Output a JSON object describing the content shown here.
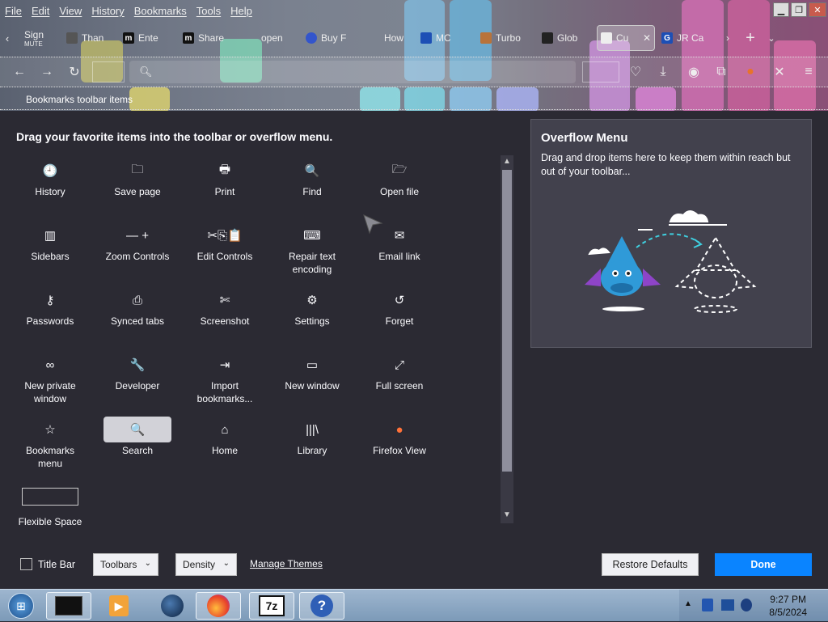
{
  "menubar": {
    "items": [
      "File",
      "Edit",
      "View",
      "History",
      "Bookmarks",
      "Tools",
      "Help"
    ]
  },
  "tabs": [
    {
      "label": "Sign",
      "sub": "MUTE",
      "color": "#333"
    },
    {
      "label": "Than",
      "color": "#555"
    },
    {
      "label": "Ente",
      "color": "#111"
    },
    {
      "label": "Share",
      "color": "#111"
    },
    {
      "label": "open",
      "color": "#666"
    },
    {
      "label": "Buy F",
      "color": "#3355cc"
    },
    {
      "label": "How",
      "color": "#888"
    },
    {
      "label": "MC",
      "color": "#1d4fb5"
    },
    {
      "label": "Turbo",
      "color": "#b8733a"
    },
    {
      "label": "Glob",
      "color": "#222"
    },
    {
      "label": "Cu",
      "color": "#eee",
      "active": true
    },
    {
      "label": "JR Ca",
      "color": "#1d4fb5"
    }
  ],
  "bookmarks_toolbar_label": "Bookmarks toolbar items",
  "instruction": "Drag your favorite items into the toolbar or overflow menu.",
  "palette": [
    {
      "label": "History",
      "icon": "history-icon",
      "glyph": "🕘"
    },
    {
      "label": "Save page",
      "icon": "save-page-icon",
      "glyph": "🗀"
    },
    {
      "label": "Print",
      "icon": "print-icon",
      "glyph": "🖶"
    },
    {
      "label": "Find",
      "icon": "find-icon",
      "glyph": "🔍"
    },
    {
      "label": "Open file",
      "icon": "open-file-icon",
      "glyph": "🗁"
    },
    {
      "label": "Sidebars",
      "icon": "sidebars-icon",
      "glyph": "▥"
    },
    {
      "label": "Zoom Controls",
      "icon": "zoom-controls-icon",
      "glyph": "— +"
    },
    {
      "label": "Edit Controls",
      "icon": "edit-controls-icon",
      "glyph": "✂⎘📋"
    },
    {
      "label": "Repair text encoding",
      "icon": "repair-encoding-icon",
      "glyph": "⌨"
    },
    {
      "label": "Email link",
      "icon": "email-link-icon",
      "glyph": "✉"
    },
    {
      "label": "Passwords",
      "icon": "passwords-icon",
      "glyph": "⚷"
    },
    {
      "label": "Synced tabs",
      "icon": "synced-tabs-icon",
      "glyph": "⎙"
    },
    {
      "label": "Screenshot",
      "icon": "screenshot-icon",
      "glyph": "✄"
    },
    {
      "label": "Settings",
      "icon": "settings-icon",
      "glyph": "⚙"
    },
    {
      "label": "Forget",
      "icon": "forget-icon",
      "glyph": "↺"
    },
    {
      "label": "New private window",
      "icon": "private-window-icon",
      "glyph": "∞"
    },
    {
      "label": "Developer",
      "icon": "developer-icon",
      "glyph": "🔧"
    },
    {
      "label": "Import bookmarks...",
      "icon": "import-bookmarks-icon",
      "glyph": "⇥"
    },
    {
      "label": "New window",
      "icon": "new-window-icon",
      "glyph": "▭"
    },
    {
      "label": "Full screen",
      "icon": "full-screen-icon",
      "glyph": "⤢"
    },
    {
      "label": "Bookmarks menu",
      "icon": "bookmarks-menu-icon",
      "glyph": "☆"
    },
    {
      "label": "Search",
      "icon": "search-icon",
      "glyph": "🔍",
      "selected": true
    },
    {
      "label": "Home",
      "icon": "home-icon",
      "glyph": "⌂"
    },
    {
      "label": "Library",
      "icon": "library-icon",
      "glyph": "|||\\"
    },
    {
      "label": "Firefox View",
      "icon": "firefox-view-icon",
      "glyph": "●"
    }
  ],
  "flexible_space_label": "Flexible Space",
  "overflow": {
    "title": "Overflow Menu",
    "description": "Drag and drop items here to keep them within reach but out of your toolbar..."
  },
  "footer": {
    "title_bar_label": "Title Bar",
    "toolbars_label": "Toolbars",
    "density_label": "Density",
    "manage_themes_label": "Manage Themes",
    "restore_defaults_label": "Restore Defaults",
    "done_label": "Done"
  },
  "clock": {
    "time": "9:27 PM",
    "date": "8/5/2024"
  },
  "colors": {
    "accent": "#0a84ff",
    "panel": "#2b2a33",
    "overflow_panel": "#42414d"
  }
}
